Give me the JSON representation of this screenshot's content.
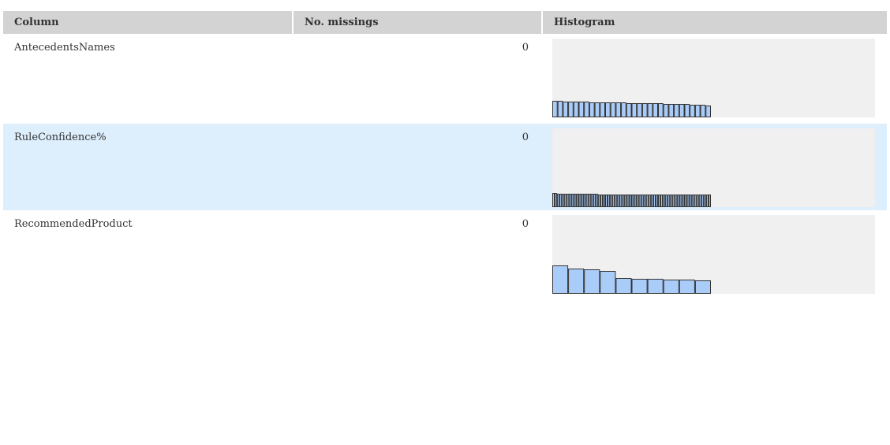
{
  "header": {
    "column_label": "Column",
    "missings_label": "No. missings",
    "histogram_label": "Histogram"
  },
  "rows": [
    {
      "name": "AntecedentsNames",
      "missings": "0",
      "histogram": {
        "bar_values": [
          21,
          21,
          20,
          20,
          20,
          20,
          20,
          19,
          19,
          19,
          19,
          19,
          19,
          19,
          18,
          18,
          18,
          18,
          18,
          18,
          18,
          17,
          17,
          17,
          17,
          17,
          16,
          16,
          16,
          15
        ]
      }
    },
    {
      "name": "RuleConfidence%",
      "missings": "0",
      "histogram": {
        "bar_values": [
          18,
          18,
          17,
          17,
          17,
          17,
          17,
          17,
          17,
          17,
          17,
          17,
          17,
          17,
          17,
          17,
          17,
          17,
          17,
          16,
          16,
          16,
          16,
          16,
          16,
          16,
          16,
          16,
          16,
          16,
          16,
          16,
          16,
          16,
          16,
          16,
          16,
          16,
          16,
          16,
          16,
          16,
          16,
          16,
          16,
          16,
          16,
          16,
          16,
          16,
          16,
          16,
          16,
          16,
          16,
          16,
          16,
          16,
          16,
          16,
          16,
          16,
          16,
          16,
          16,
          16
        ]
      }
    },
    {
      "name": "RecommendedProduct",
      "missings": "0",
      "histogram": {
        "bar_values": [
          36,
          32,
          31,
          29,
          20,
          19,
          19,
          18,
          18,
          17
        ]
      }
    }
  ],
  "colors": {
    "header_bg": "#d3d3d3",
    "selected_row_bg": "#ddeefc",
    "histogram_bg": "#f0f0f0",
    "bar_fill": "#aaccf9",
    "bar_stroke": "#333333"
  }
}
